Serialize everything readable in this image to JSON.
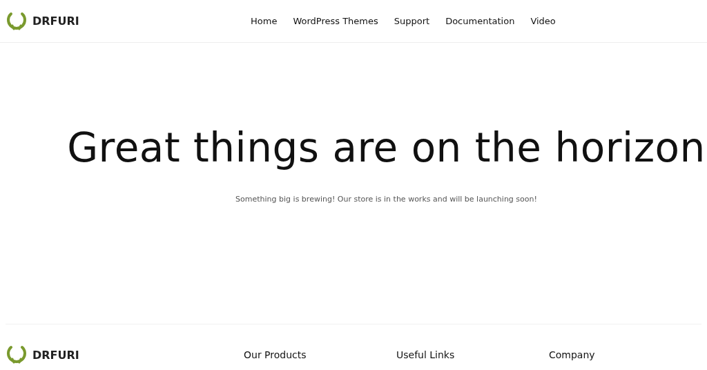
{
  "header": {
    "logo": "DRFURI",
    "nav": [
      {
        "label": "Home"
      },
      {
        "label": "WordPress Themes"
      },
      {
        "label": "Support"
      },
      {
        "label": "Documentation"
      },
      {
        "label": "Video"
      }
    ]
  },
  "hero": {
    "title": "Great things are on the horizon",
    "subtitle": "Something big is brewing! Our store is in the works and will be launching soon!"
  },
  "footer": {
    "logo": "DRFURI",
    "columns": [
      {
        "heading": "Our Products"
      },
      {
        "heading": "Useful Links"
      },
      {
        "heading": "Company"
      }
    ]
  }
}
